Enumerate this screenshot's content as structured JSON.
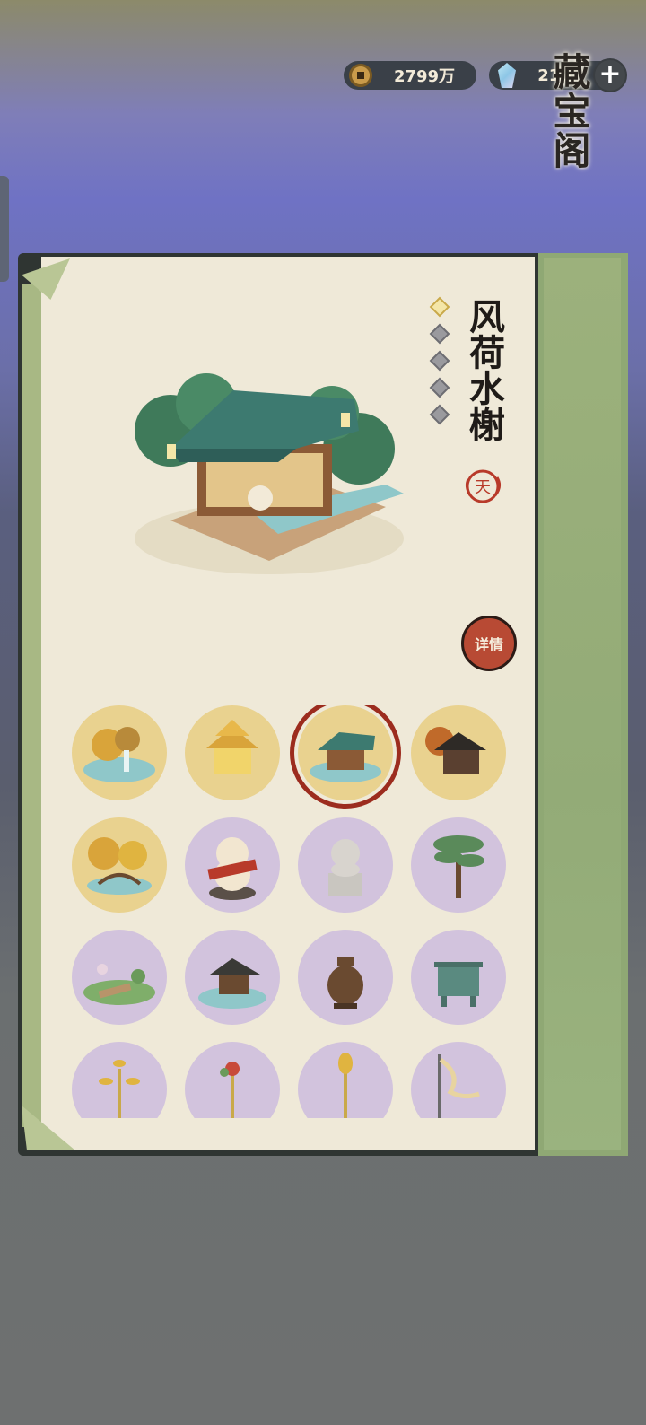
{
  "currency": {
    "coins": {
      "icon": "copper-coin-icon",
      "value": "2799万"
    },
    "gems": {
      "icon": "crystal-gem-icon",
      "value": "216",
      "add_label": "+"
    }
  },
  "panel": {
    "title": "藏宝阁",
    "building": {
      "name": "风荷水榭",
      "star_count": 5,
      "stars_lit": 1,
      "grade_label": "天",
      "details_button": "详情"
    }
  },
  "items": [
    {
      "name": "golden-garden-waterfall",
      "rarity": "gold",
      "selected": false
    },
    {
      "name": "golden-pavilion",
      "rarity": "gold",
      "selected": false
    },
    {
      "name": "lotus-water-pavilion",
      "rarity": "gold",
      "selected": true
    },
    {
      "name": "autumn-house",
      "rarity": "gold",
      "selected": false
    },
    {
      "name": "ginkgo-bridge",
      "rarity": "gold",
      "selected": false
    },
    {
      "name": "cat-statue-banner",
      "rarity": "purple",
      "selected": false
    },
    {
      "name": "stone-lion",
      "rarity": "purple",
      "selected": false
    },
    {
      "name": "pine-tree",
      "rarity": "purple",
      "selected": false
    },
    {
      "name": "lotus-pond-path",
      "rarity": "purple",
      "selected": false
    },
    {
      "name": "pond-pavilion",
      "rarity": "purple",
      "selected": false
    },
    {
      "name": "incense-burner",
      "rarity": "purple",
      "selected": false
    },
    {
      "name": "bronze-ding",
      "rarity": "purple",
      "selected": false
    },
    {
      "name": "gold-lamp-tree",
      "rarity": "purple",
      "selected": false
    },
    {
      "name": "flower-lantern-post",
      "rarity": "purple",
      "selected": false
    },
    {
      "name": "gold-finial-pole",
      "rarity": "purple",
      "selected": false
    },
    {
      "name": "ribbon-flag-pole",
      "rarity": "purple",
      "selected": false
    }
  ],
  "colors": {
    "gold_bg": "#e9d28f",
    "purple_bg": "#d2c3dd",
    "selected_ring": "#9c2c1e",
    "details_button": "#b84a34"
  }
}
